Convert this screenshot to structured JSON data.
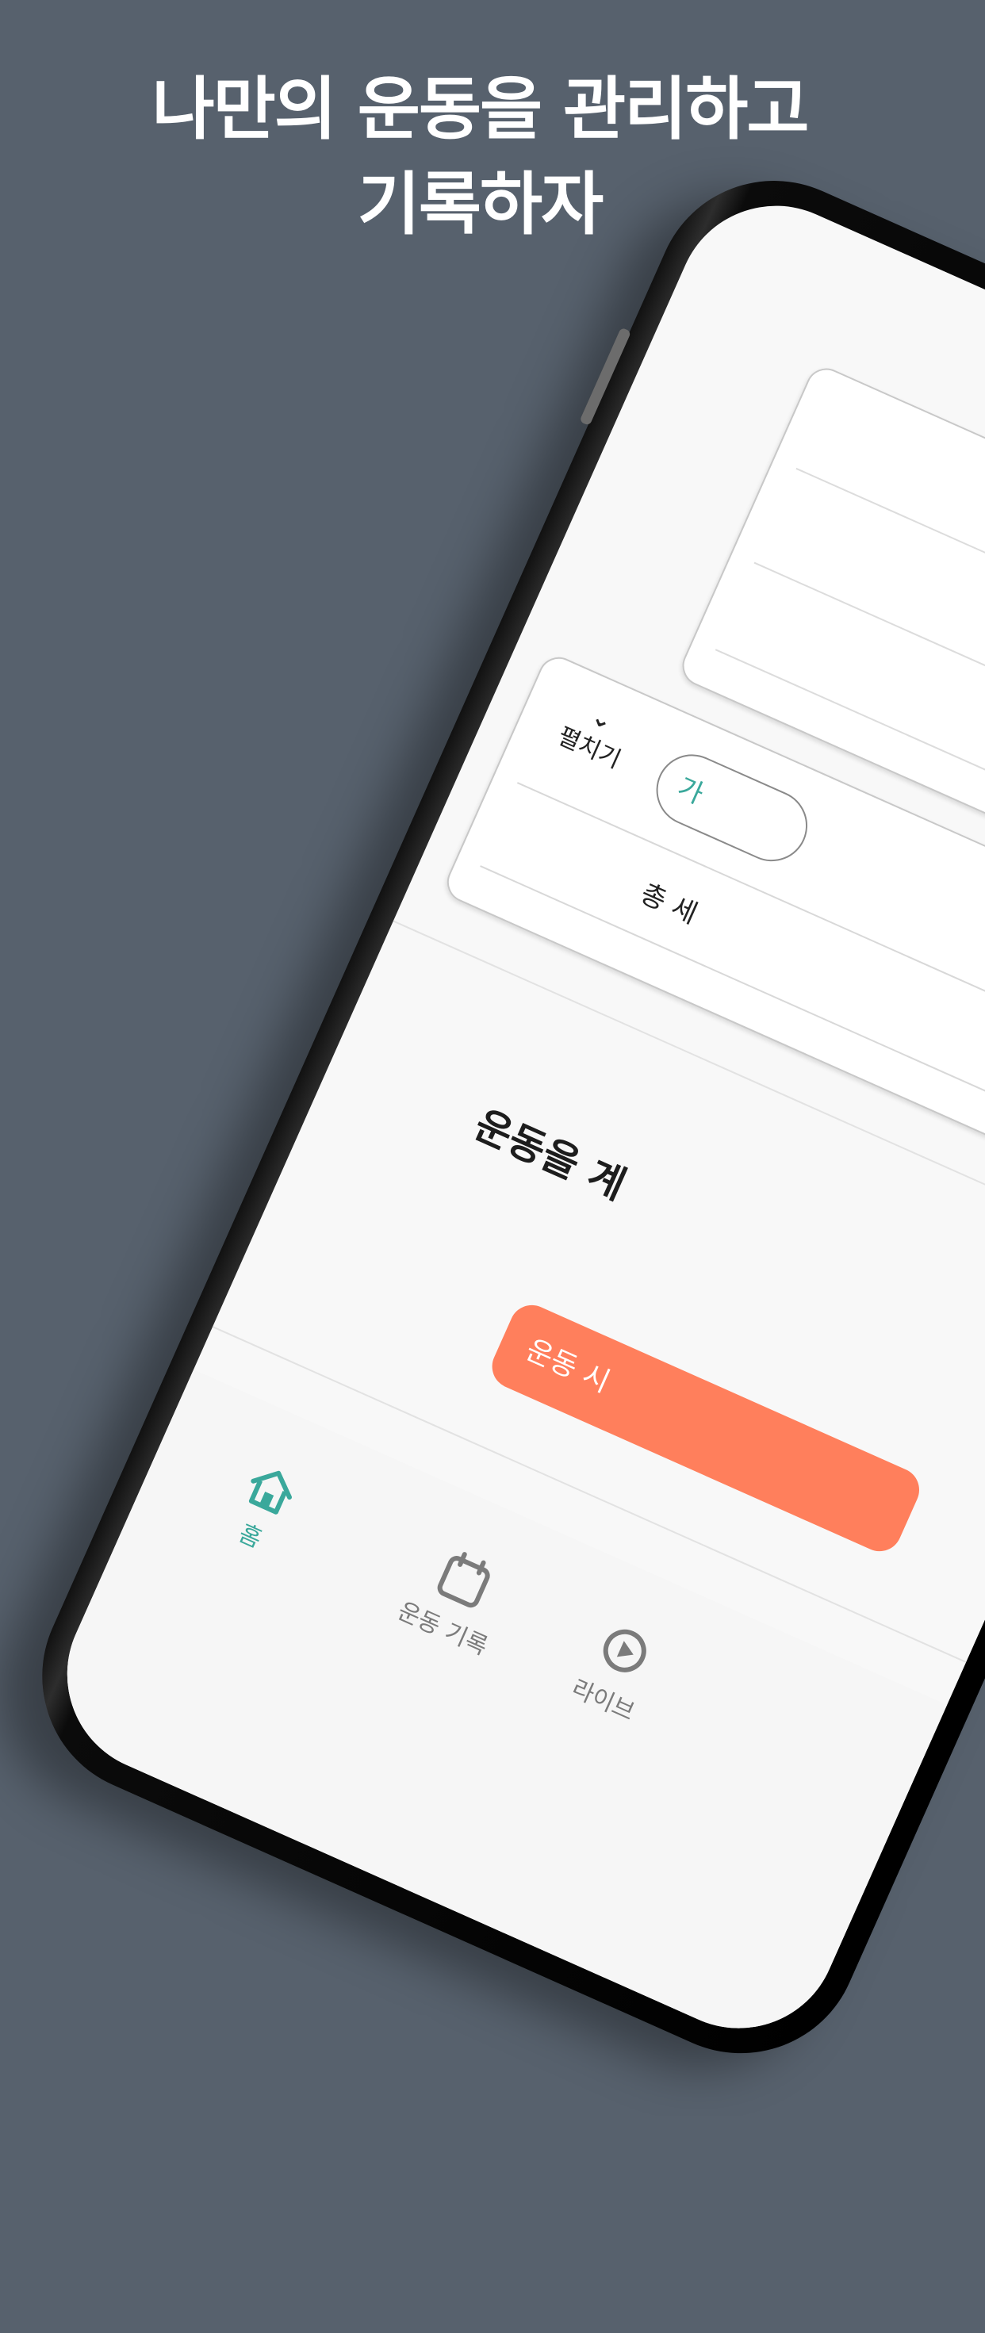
{
  "headline": {
    "line1": "나만의 운동을 관리하고",
    "line2": "기록하자"
  },
  "screen": {
    "expand_label": "펼치기",
    "chip_label": "가",
    "total_sets_label": "총 세",
    "empty_message": "운동을 계",
    "start_button_label": "운동 시"
  },
  "tabbar": {
    "items": [
      {
        "label": "홈",
        "icon": "home-icon",
        "active": true
      },
      {
        "label": "운동 기록",
        "icon": "calendar-icon",
        "active": false
      },
      {
        "label": "라이브",
        "icon": "live-icon",
        "active": false
      }
    ]
  },
  "colors": {
    "background": "#57616d",
    "accent": "#3aa89b",
    "start_button": "#ff7f5c"
  }
}
